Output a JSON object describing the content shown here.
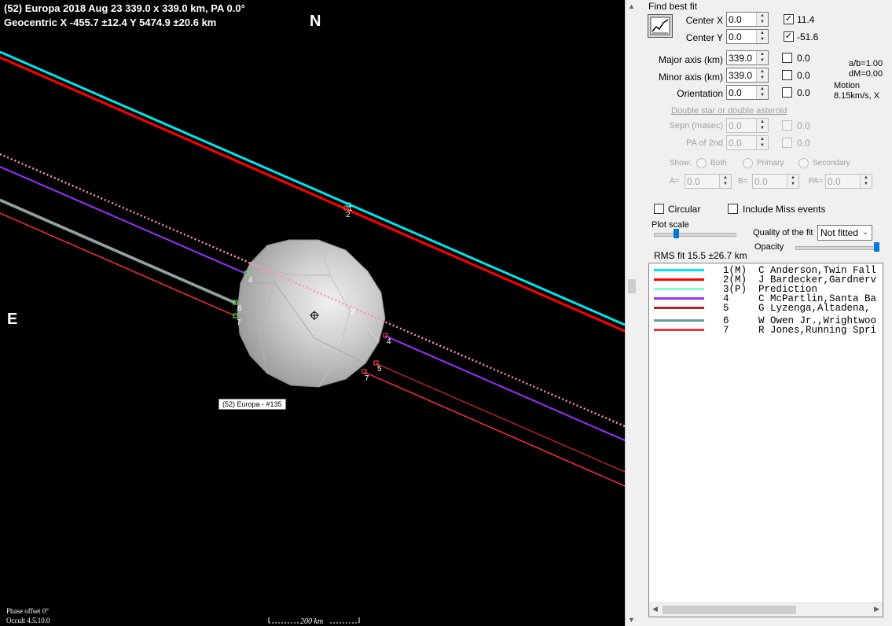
{
  "plot": {
    "title_line1": "(52) Europa  2018 Aug 23  339.0 x 339.0 km, PA 0.0°",
    "title_line2": "Geocentric  X  -455.7 ±12.4  Y 5474.9 ±20.6 km",
    "north": "N",
    "east": "E",
    "object_tag": "(52) Europa - #135",
    "phase_offset": "Phase offset 0°",
    "version": "Occult 4.5.10.0",
    "scale_label": "200 km",
    "chord_labels": [
      "1",
      "2",
      "4",
      "6",
      "7",
      "3",
      "4",
      "5",
      "7"
    ]
  },
  "panel": {
    "find_best_fit": "Find best fit",
    "center_x": {
      "label": "Center X",
      "value": "0.0",
      "check_value": "11.4",
      "checked": true
    },
    "center_y": {
      "label": "Center Y",
      "value": "0.0",
      "check_value": "-51.6",
      "checked": true
    },
    "major_axis": {
      "label": "Major axis (km)",
      "value": "339.0",
      "check_value": "0.0"
    },
    "minor_axis": {
      "label": "Minor axis (km)",
      "value": "339.0",
      "check_value": "0.0"
    },
    "orientation": {
      "label": "Orientation",
      "value": "0.0",
      "check_value": "0.0"
    },
    "ab_ratio": "a/b=1.00",
    "dm": "dM=0.00",
    "motion_label": "Motion",
    "motion_value": "8.15km/s, X",
    "double_star": "Double star  or  double asteroid",
    "sepn": {
      "label": "Sepn (masec)",
      "value": "0.0",
      "check_value": "0.0"
    },
    "pa2": {
      "label": "PA of 2nd",
      "value": "0.0",
      "check_value": "0.0"
    },
    "show_label": "Show:",
    "show_both": "Both",
    "show_primary": "Primary",
    "show_secondary": "Secondary",
    "a_label": "A=",
    "a_value": "0.0",
    "b_label": "B=",
    "b_value": "0.0",
    "pa_label": "PA=",
    "pa_value": "0.0",
    "circular": "Circular",
    "include_miss": "Include Miss events",
    "plot_scale": "Plot scale",
    "quality_label": "Quality of the fit",
    "quality_value": "Not fitted",
    "opacity": "Opacity",
    "rms_fit": "RMS fit 15.5 ±26.7 km"
  },
  "legend": [
    {
      "text": "1(M)  C Anderson,Twin Fall",
      "color": "#00e5ee"
    },
    {
      "text": "2(M)  J Bardecker,Gardnerv",
      "color": "#ff0000"
    },
    {
      "text": "3(P)  Prediction",
      "color": "#80ffcc"
    },
    {
      "text": "4     C McPartlin,Santa Ba",
      "color": "#9b30ff"
    },
    {
      "text": "5     G Lyzenga,Altadena,",
      "color": "#b22222"
    },
    {
      "text": "6     W Owen Jr.,Wrightwoo",
      "color": "#5f9ea0"
    },
    {
      "text": "7     R Jones,Running Spri",
      "color": "#ff2a3a"
    }
  ]
}
